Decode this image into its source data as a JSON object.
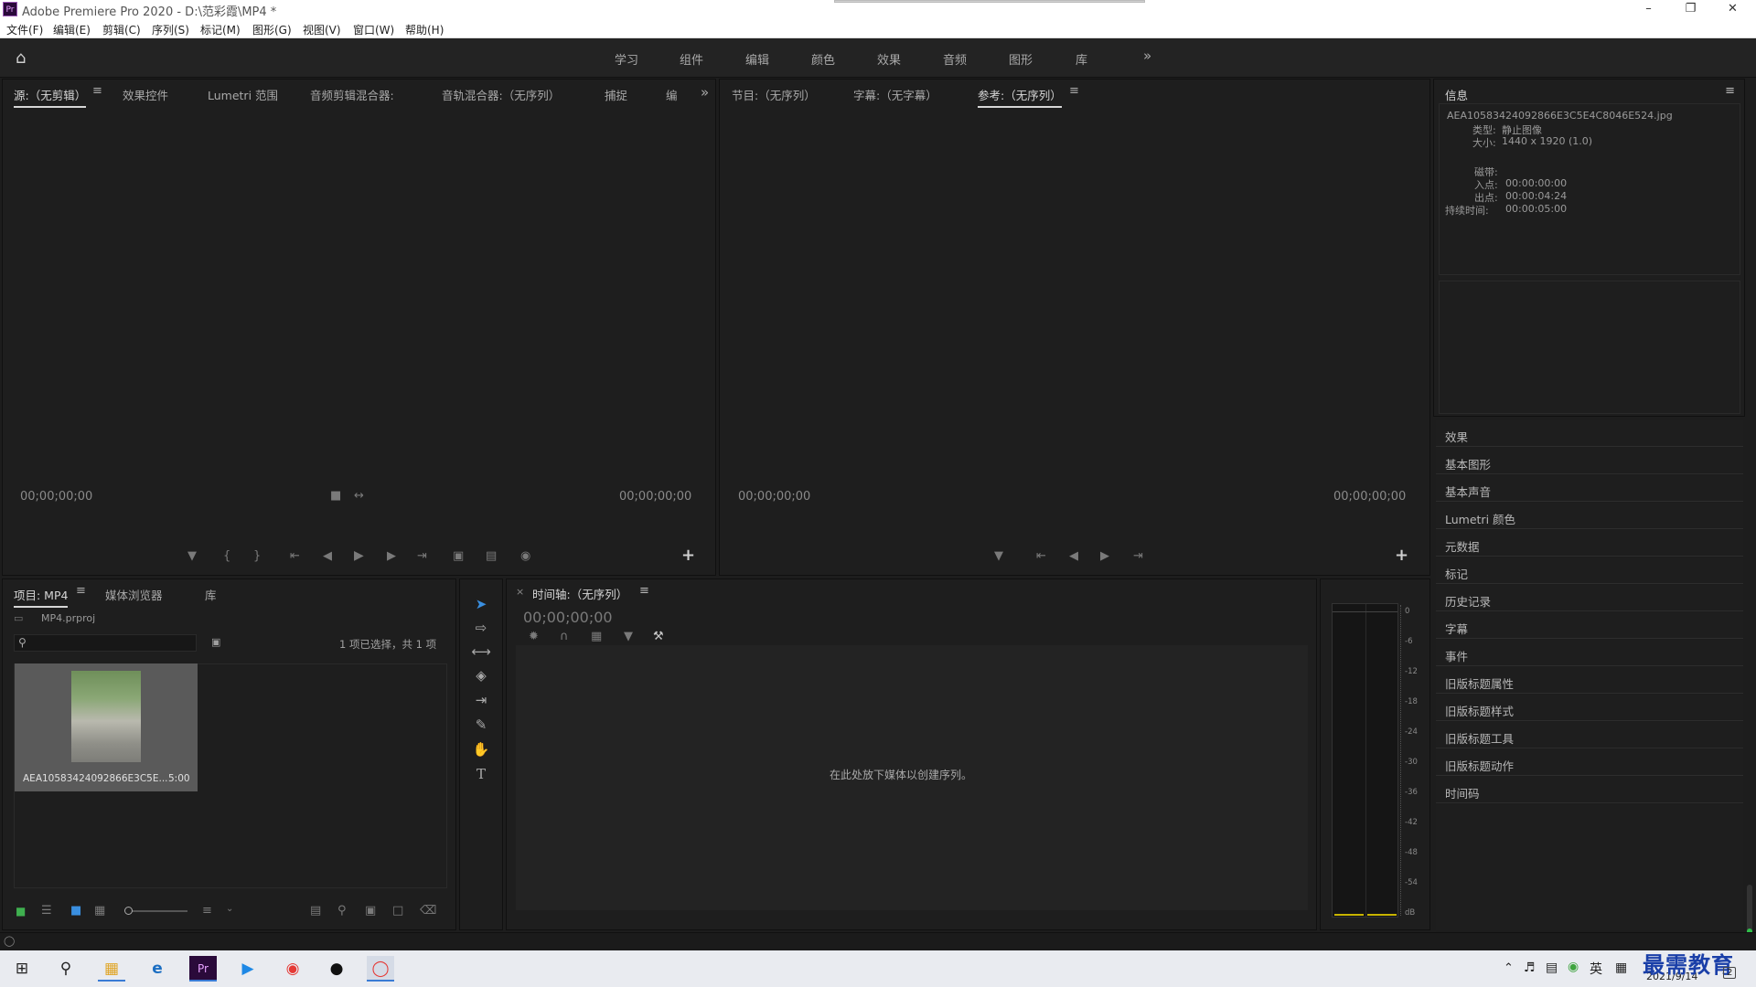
{
  "window": {
    "title": "Adobe Premiere Pro 2020 - D:\\范彩霞\\MP4 *",
    "app_icon": "Pr"
  },
  "menu": [
    "文件(F)",
    "编辑(E)",
    "剪辑(C)",
    "序列(S)",
    "标记(M)",
    "图形(G)",
    "视图(V)",
    "窗口(W)",
    "帮助(H)"
  ],
  "workspaces": [
    "学习",
    "组件",
    "编辑",
    "颜色",
    "效果",
    "音频",
    "图形",
    "库"
  ],
  "source_panel": {
    "tabs": [
      "源:（无剪辑）",
      "效果控件",
      "Lumetri 范围",
      "音频剪辑混合器:",
      "音轨混合器:（无序列）",
      "捕捉",
      "编"
    ],
    "tc_left": "00;00;00;00",
    "tc_right": "00;00;00;00"
  },
  "program_panel": {
    "tabs": [
      "节目:（无序列）",
      "字幕:（无字幕）",
      "参考:（无序列）"
    ],
    "tc_left": "00;00;00;00",
    "tc_right": "00;00;00;00"
  },
  "info_panel": {
    "title": "信息",
    "filename": "AEA10583424092866E3C5E4C8046E524.jpg",
    "type_label": "类型:",
    "type_value": "静止图像",
    "size_label": "大小:",
    "size_value": "1440 x 1920 (1.0)",
    "tape_label": "磁带:",
    "in_label": "入点:",
    "in_value": "00:00:00:00",
    "out_label": "出点:",
    "out_value": "00:00:04:24",
    "duration_label": "持续时间:",
    "duration_value": "00:00:05:00"
  },
  "right_panels": [
    "效果",
    "基本图形",
    "基本声音",
    "Lumetri 颜色",
    "元数据",
    "标记",
    "历史记录",
    "字幕",
    "事件",
    "旧版标题属性",
    "旧版标题样式",
    "旧版标题工具",
    "旧版标题动作",
    "时间码"
  ],
  "project_panel": {
    "tabs": [
      "项目: MP4",
      "媒体浏览器",
      "库"
    ],
    "proj_file": "MP4.prproj",
    "search_placeholder": "",
    "selection_status": "1 项已选择，共 1 项",
    "item_name": "AEA10583424092866E3C5E...",
    "item_duration": "5:00"
  },
  "timeline": {
    "tab": "时间轴:（无序列）",
    "timecode": "00;00;00;00",
    "drop_hint": "在此处放下媒体以创建序列。"
  },
  "audio_meter": {
    "ticks": [
      "0",
      "-6",
      "-12",
      "-18",
      "-24",
      "-30",
      "-36",
      "-42",
      "-48",
      "-54",
      "dB"
    ]
  },
  "taskbar": {
    "time": "",
    "date": "2021/9/14",
    "ime": "英",
    "watermark": "最需教育",
    "notification_count": "2"
  }
}
